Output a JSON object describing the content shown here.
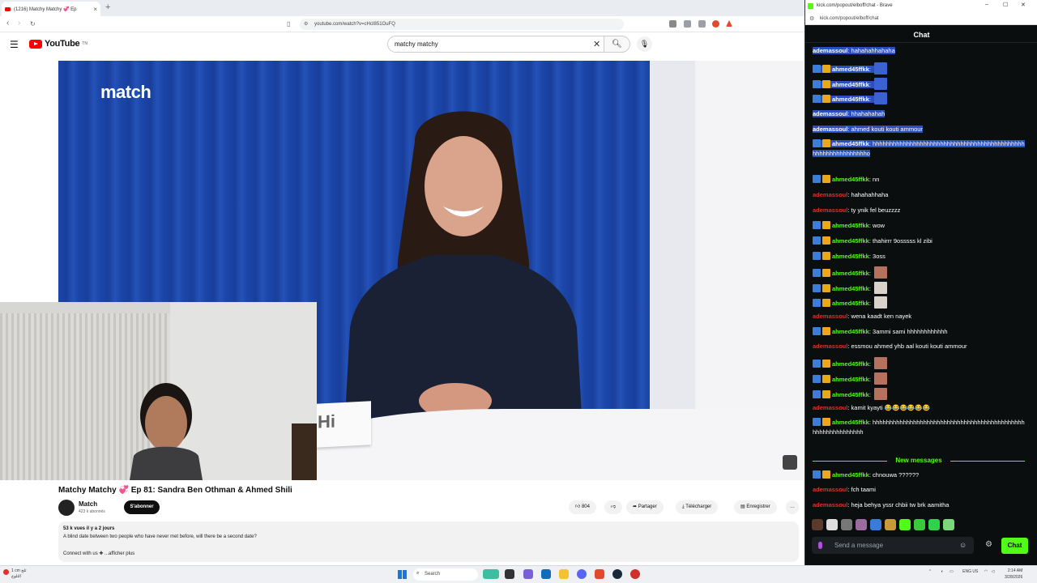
{
  "browser_left": {
    "tab_title": "(1216) Matchy Matchy 💞 Ep",
    "url": "youtube.com/watch?v=cHcI851OuFQ",
    "search_query": "matchy matchy"
  },
  "youtube": {
    "logo_text": "YouTube",
    "logo_sup": "TN",
    "video_brand": "match",
    "namecard_text": "Hi",
    "video_title": "Matchy Matchy 💞 Ep 81: Sandra Ben Othman & Ahmed Shili",
    "channel_name": "Match",
    "subs": "423 k abonnés",
    "subscribe_label": "S'abonner",
    "likes": "804",
    "share_label": "Partager",
    "download_label": "Télécharger",
    "save_label": "Enregistrer",
    "more_label": "…",
    "desc_meta": "53 k vues  il y a 2 jours",
    "desc_text": "A blind date between two people who have never met before, will there be a second date?",
    "desc_more": "Connect with us ✚ ...afficher plus"
  },
  "chat_window": {
    "title": "kick.com/popout/elboff/chat - Brave",
    "url": "kick.com/popout/elboff/chat",
    "header": "Chat",
    "new_messages_label": "New messages",
    "input_placeholder": "Send a message",
    "send_label": "Chat",
    "messages": [
      {
        "user": "ademassoul",
        "text": "hahahahhahaha"
      },
      {
        "user": "ahmed45ffkk",
        "text": ""
      },
      {
        "user": "ahmed45ffkk",
        "text": ""
      },
      {
        "user": "ahmed45ffkk",
        "text": ""
      },
      {
        "user": "ademassoul",
        "text": "hhahahahah"
      },
      {
        "user": "ademassoul",
        "text": "ahmed kouti kouti ammour"
      },
      {
        "user": "ahmed45ffkk",
        "text": "hhhhhhhhhhhhhhhhhhhhhhhhhhhhhhhhhhhhhhhhhhhhhhhhhhhhhhhhhhhhho"
      },
      {
        "user": "ahmed45ffkk",
        "text": "nn"
      },
      {
        "user": "ademassoul",
        "text": "hahahahhaha"
      },
      {
        "user": "ademassoul",
        "text": "ty ynik fel beuzzzz"
      },
      {
        "user": "ahmed45ffkk",
        "text": "wow"
      },
      {
        "user": "ahmed45ffkk",
        "text": "thahirrr 9osssss kl zibi"
      },
      {
        "user": "ahmed45ffkk",
        "text": "3oss"
      },
      {
        "user": "ahmed45ffkk",
        "text": ""
      },
      {
        "user": "ahmed45ffkk",
        "text": ""
      },
      {
        "user": "ahmed45ffkk",
        "text": ""
      },
      {
        "user": "ademassoul",
        "text": "wena kaadt ken nayek"
      },
      {
        "user": "ahmed45ffkk",
        "text": "3ammi sami hhhhhhhhhhhh"
      },
      {
        "user": "ademassoul",
        "text": "essmou ahmed yhb aal kouti kouti ammour"
      },
      {
        "user": "ahmed45ffkk",
        "text": ""
      },
      {
        "user": "ahmed45ffkk",
        "text": ""
      },
      {
        "user": "ahmed45ffkk",
        "text": ""
      },
      {
        "user": "ademassoul",
        "text": "kamit kyayti 😂😂😂😂😂😂"
      },
      {
        "user": "ahmed45ffkk",
        "text": "hhhhhhhhhhhhhhhhhhhhhhhhhhhhhhhhhhhhhhhhhhhhhhhhhhhhhhhhhhhh"
      },
      {
        "user": "ahmed45ffkk",
        "text": "chnouwa ??????"
      },
      {
        "user": "ademassoul",
        "text": "fch taami"
      },
      {
        "user": "ademassoul",
        "text": "heja behya yssr chbii tw brk aamitha"
      }
    ]
  },
  "taskbar": {
    "weather_temp": "1 cm ثلج",
    "weather_desc": "الثلوج",
    "search_label": "Search",
    "lang": "ENG US",
    "time": "2:14 AM",
    "date": "3/28/2026"
  },
  "colors": {
    "kick_green": "#53fc18",
    "yt_red": "#ff0000",
    "chat_bg": "#0b0e0f",
    "highlight": "#2b4fbd",
    "user_red": "#e0302a"
  }
}
